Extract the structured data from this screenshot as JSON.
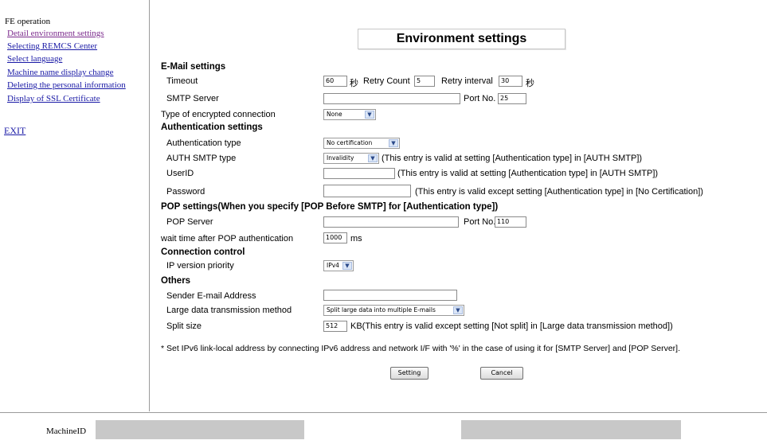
{
  "sidebar": {
    "heading": "FE operation",
    "links": [
      "Detail environment settings",
      "Selecting REMCS Center",
      "Select language",
      "Machine name display change",
      "Deleting the personal information",
      "Display of SSL Certificate"
    ],
    "exit": "EXIT"
  },
  "page": {
    "title": "Environment settings"
  },
  "email": {
    "section": "E-Mail settings",
    "timeout_label": "Timeout",
    "timeout_value": "60",
    "timeout_unit": "秒",
    "retry_count_label": "Retry Count",
    "retry_count_value": "5",
    "retry_interval_label": "Retry interval",
    "retry_interval_value": "30",
    "retry_interval_unit": "秒",
    "smtp_server_label": "SMTP Server",
    "smtp_server_value": "",
    "smtp_port_label": "Port No.",
    "smtp_port_value": "25",
    "encryption_label": "Type of encrypted connection",
    "encryption_value": "None"
  },
  "auth": {
    "section": "Authentication settings",
    "type_label": "Authentication type",
    "type_value": "No certification",
    "smtp_type_label": "AUTH SMTP type",
    "smtp_type_value": "Invalidity",
    "smtp_type_note": "(This entry is valid at setting [Authentication type] in [AUTH SMTP])",
    "userid_label": "UserID",
    "userid_value": "",
    "userid_note": "(This entry is valid at setting [Authentication type] in [AUTH SMTP])",
    "password_label": "Password",
    "password_value": "",
    "password_note": "(This entry is valid except setting [Authentication type] in [No Certification])"
  },
  "pop": {
    "section": "POP settings(When you specify [POP Before SMTP] for [Authentication type])",
    "server_label": "POP Server",
    "server_value": "",
    "port_label": "Port No.",
    "port_value": "110",
    "wait_label": "wait time after POP authentication",
    "wait_value": "1000",
    "wait_unit": "ms"
  },
  "connection": {
    "section": "Connection control",
    "ip_label": "IP version priority",
    "ip_value": "IPv4"
  },
  "others": {
    "section": "Others",
    "sender_label": "Sender E-mail Address",
    "sender_value": "",
    "large_label": "Large data transmission method",
    "large_value": "Split large data into multiple E-mails",
    "split_label": "Split size",
    "split_value": "512",
    "split_note": "KB(This entry is valid except setting [Not split] in [Large data transmission method])"
  },
  "footnote": "* Set IPv6 link-local address by connecting IPv6 address and network I/F with '%' in the case of using it for [SMTP Server] and [POP Server].",
  "buttons": {
    "setting": "Setting",
    "cancel": "Cancel"
  },
  "footer": {
    "machine_id_label": "MachineID"
  }
}
